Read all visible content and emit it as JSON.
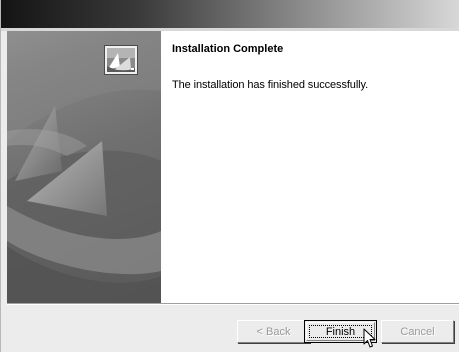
{
  "dialog": {
    "heading": "Installation Complete",
    "message": "The installation has finished successfully."
  },
  "buttons": {
    "back_label": "< Back",
    "finish_label": "Finish",
    "cancel_label": "Cancel"
  },
  "icons": {
    "app_icon": "installer-app-icon",
    "cursor": "mouse-pointer-icon"
  },
  "colors": {
    "title_gradient_start": "#141414",
    "title_gradient_end": "#d8d8d8",
    "content_bg": "#ffffff",
    "footer_bg": "#ececec"
  }
}
